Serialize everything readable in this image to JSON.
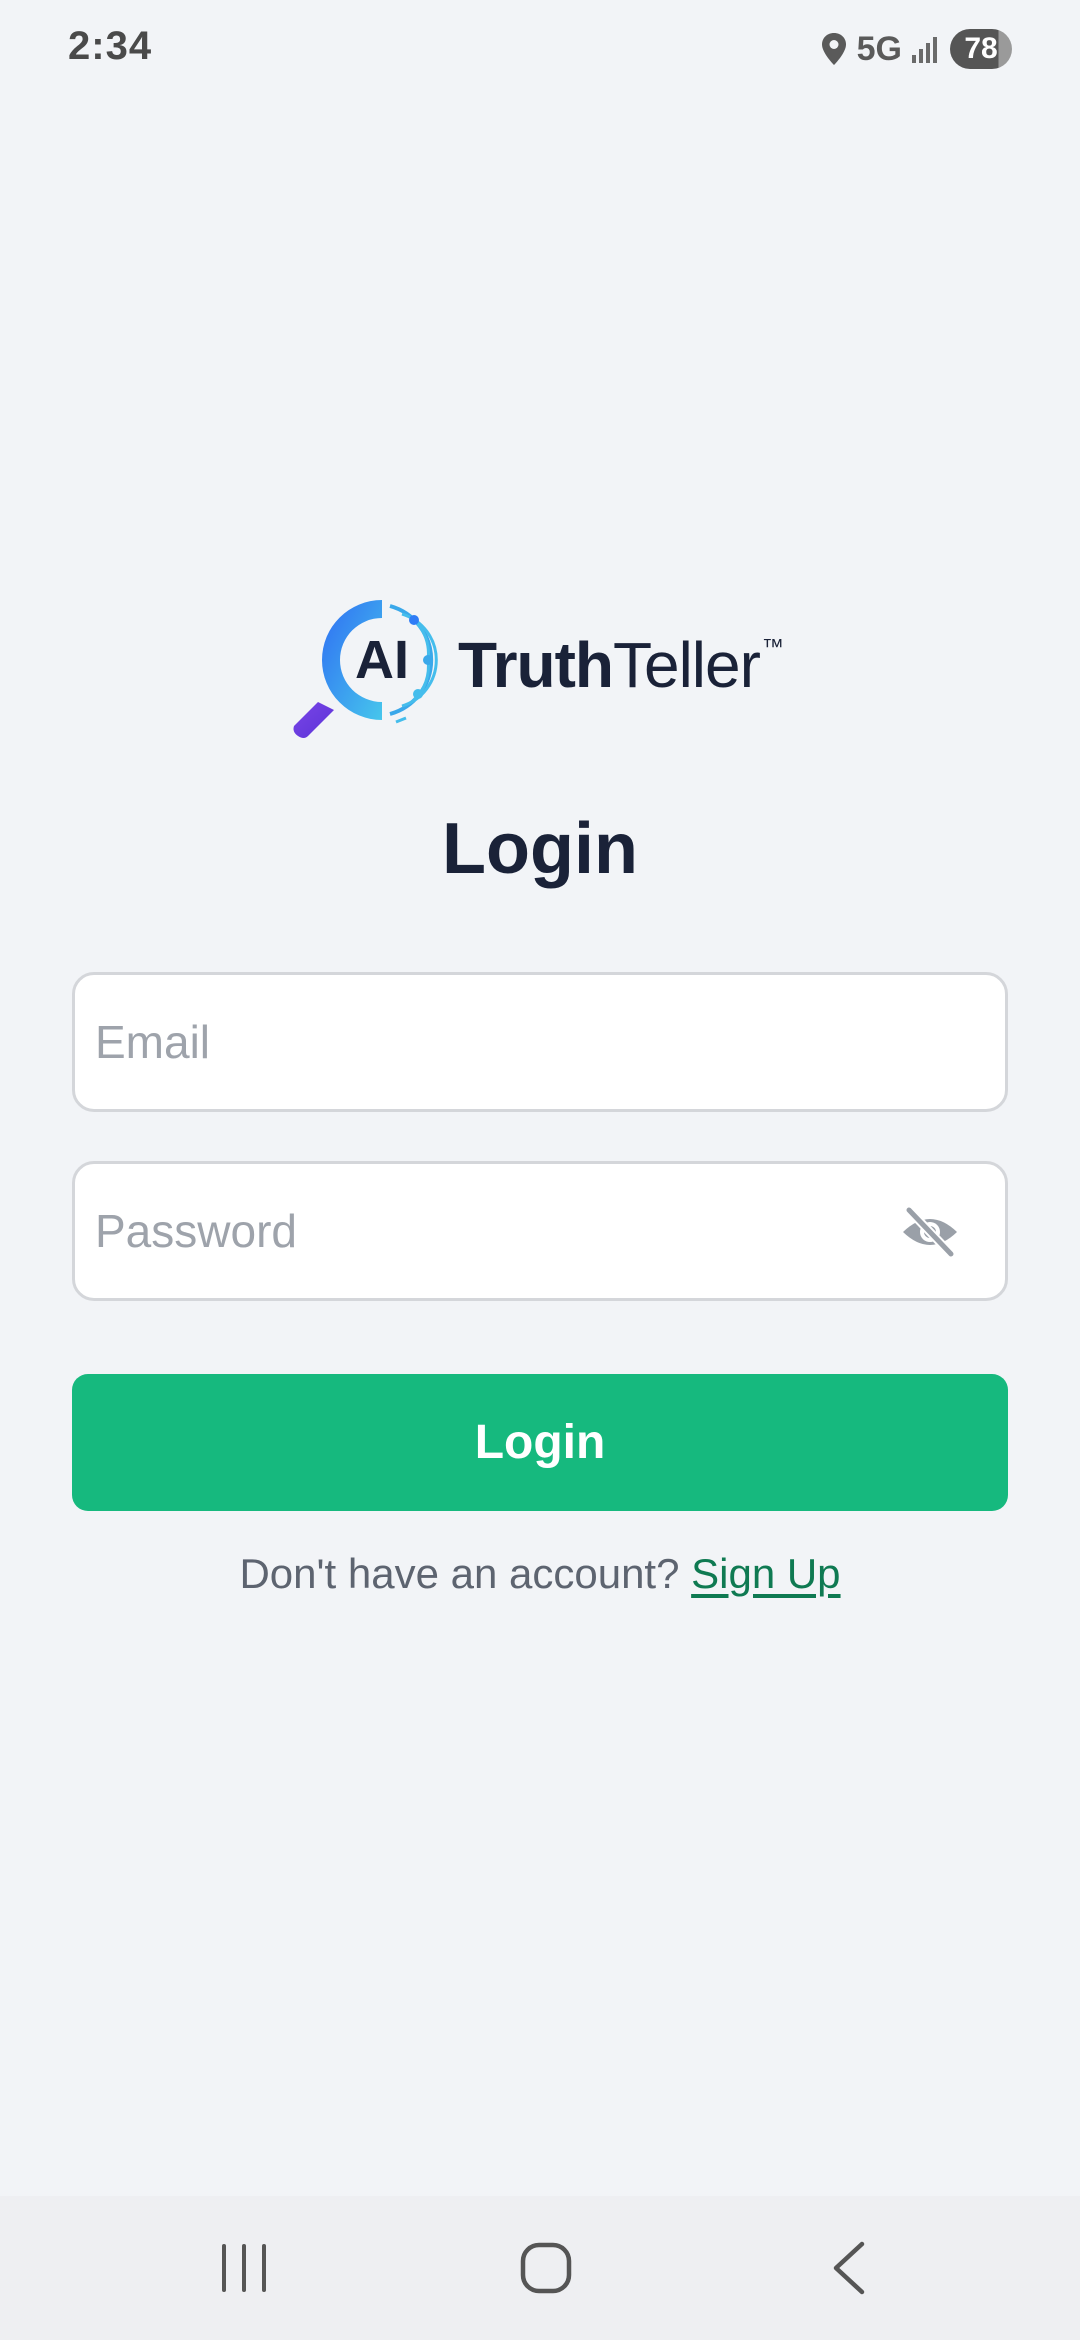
{
  "status_bar": {
    "time": "2:34",
    "network": "5G",
    "battery": "78",
    "icons": [
      "location-icon",
      "signal-icon"
    ]
  },
  "logo": {
    "mark_text": "AI",
    "name_bold": "Truth",
    "name_regular": "Teller",
    "trademark": "™",
    "colors": {
      "ring_start": "#2f7cf6",
      "ring_end": "#5bd0ea",
      "handle": "#6b3fe0",
      "text": "#1a2238"
    }
  },
  "page": {
    "title": "Login"
  },
  "form": {
    "email": {
      "placeholder": "Email",
      "value": ""
    },
    "password": {
      "placeholder": "Password",
      "value": "",
      "toggle_icon": "eye-off-icon"
    },
    "submit_label": "Login",
    "submit_color": "#16b97e"
  },
  "signup": {
    "prompt": "Don't have an account?",
    "link_label": "Sign Up",
    "link_color": "#0f7a52"
  },
  "nav_bar": {
    "icons": [
      "recents-icon",
      "home-icon",
      "back-icon"
    ]
  }
}
